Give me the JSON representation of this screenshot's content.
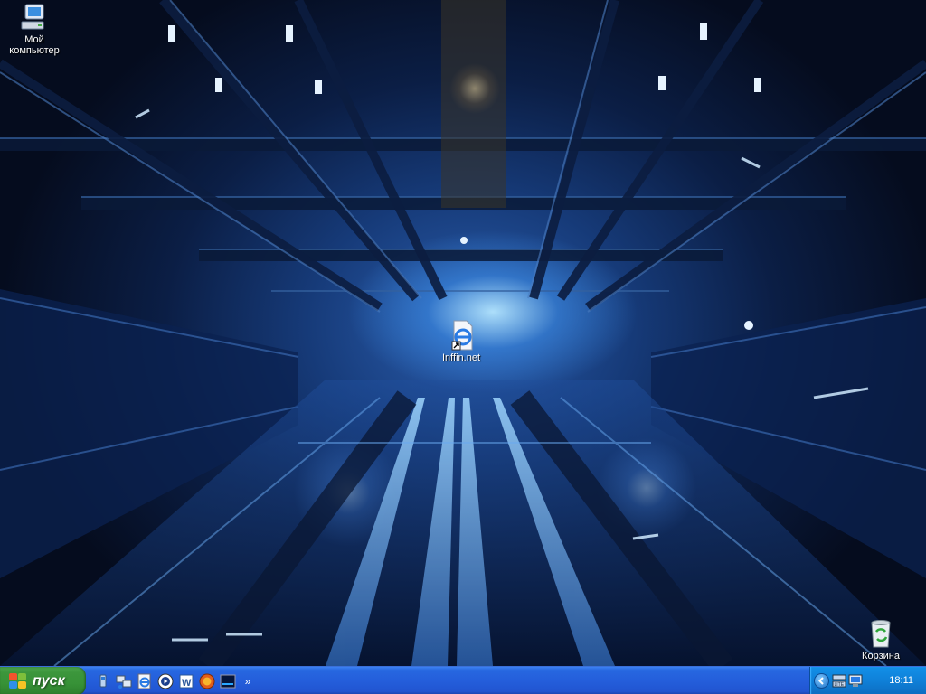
{
  "desktop": {
    "icons": [
      {
        "label": "Мой компьютер",
        "icon": "my-computer-icon"
      },
      {
        "label": "Inffin.net",
        "icon": "internet-explorer-shortcut-icon"
      },
      {
        "label": "Корзина",
        "icon": "recycle-bin-icon"
      }
    ]
  },
  "taskbar": {
    "start_label": "пуск",
    "quick_launch": [
      {
        "icon": "show-desktop-icon"
      },
      {
        "icon": "network-icon"
      },
      {
        "icon": "internet-explorer-icon"
      },
      {
        "icon": "media-player-icon"
      },
      {
        "icon": "word-icon"
      },
      {
        "icon": "firefox-icon"
      },
      {
        "icon": "terminal-icon"
      }
    ],
    "more_label": "»",
    "language": "RL",
    "tray": {
      "icons": [
        "show-hidden-icons-chevron",
        "network-status-icon",
        "monitor-icon"
      ],
      "clock": "18:11"
    }
  },
  "colors": {
    "taskbar": "#245edb",
    "start_button": "#3c963c",
    "tray": "#0f80d8",
    "wallpaper_glow": "#4fa7ff"
  }
}
